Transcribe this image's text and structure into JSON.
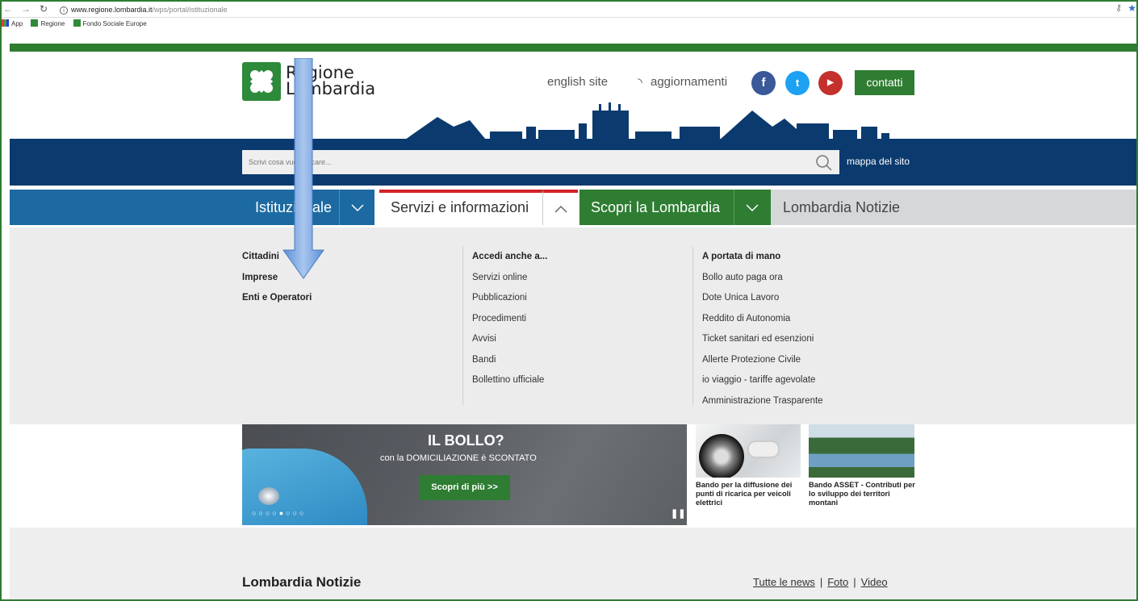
{
  "browser": {
    "url_host": "www.regione.lombardia.it",
    "url_path": "/wps/portal/istituzionale",
    "bookmarks": [
      "App",
      "Regione",
      "Fondo Sociale Europe"
    ]
  },
  "header": {
    "logo_line1": "Regione",
    "logo_line2": "Lombardia",
    "english_site": "english site",
    "aggiornamenti": "aggiornamenti",
    "contatti": "contatti",
    "social": [
      "facebook-icon",
      "twitter-icon",
      "youtube-icon"
    ],
    "social_colors": [
      "#3b5998",
      "#1da1f2",
      "#c4302b"
    ]
  },
  "search": {
    "placeholder": "Scrivi cosa vuoi cercare...",
    "sitemap": "mappa del sito"
  },
  "nav": {
    "items": [
      "Istituzionale",
      "Servizi e informazioni",
      "Scopri la Lombardia",
      "Lombardia Notizie"
    ]
  },
  "dropdown": {
    "col1": [
      "Cittadini",
      "Imprese",
      "Enti e Operatori"
    ],
    "col2_title": "Accedi anche a...",
    "col2": [
      "Servizi online",
      "Pubblicazioni",
      "Procedimenti",
      "Avvisi",
      "Bandi",
      "Bollettino ufficiale"
    ],
    "col3_title": "A portata di mano",
    "col3": [
      "Bollo auto paga ora",
      "Dote Unica Lavoro",
      "Reddito di Autonomia",
      "Ticket sanitari ed esenzioni",
      "Allerte Protezione Civile",
      "io viaggio - tariffe agevolate",
      "Amministrazione Trasparente"
    ]
  },
  "hero": {
    "title": "IL BOLLO?",
    "subtitle": "con la DOMICILIAZIONE è SCONTATO",
    "button": "Scopri di più >>",
    "dots": "○○○○●○○○"
  },
  "cards": [
    {
      "text": "Bando per la diffusione dei punti di ricarica per veicoli elettrici"
    },
    {
      "text": "Bando ASSET - Contributi per lo sviluppo dei territori montani"
    }
  ],
  "news": {
    "title": "Lombardia Notizie",
    "links": [
      "Tutte le news",
      "Foto",
      "Video"
    ]
  }
}
